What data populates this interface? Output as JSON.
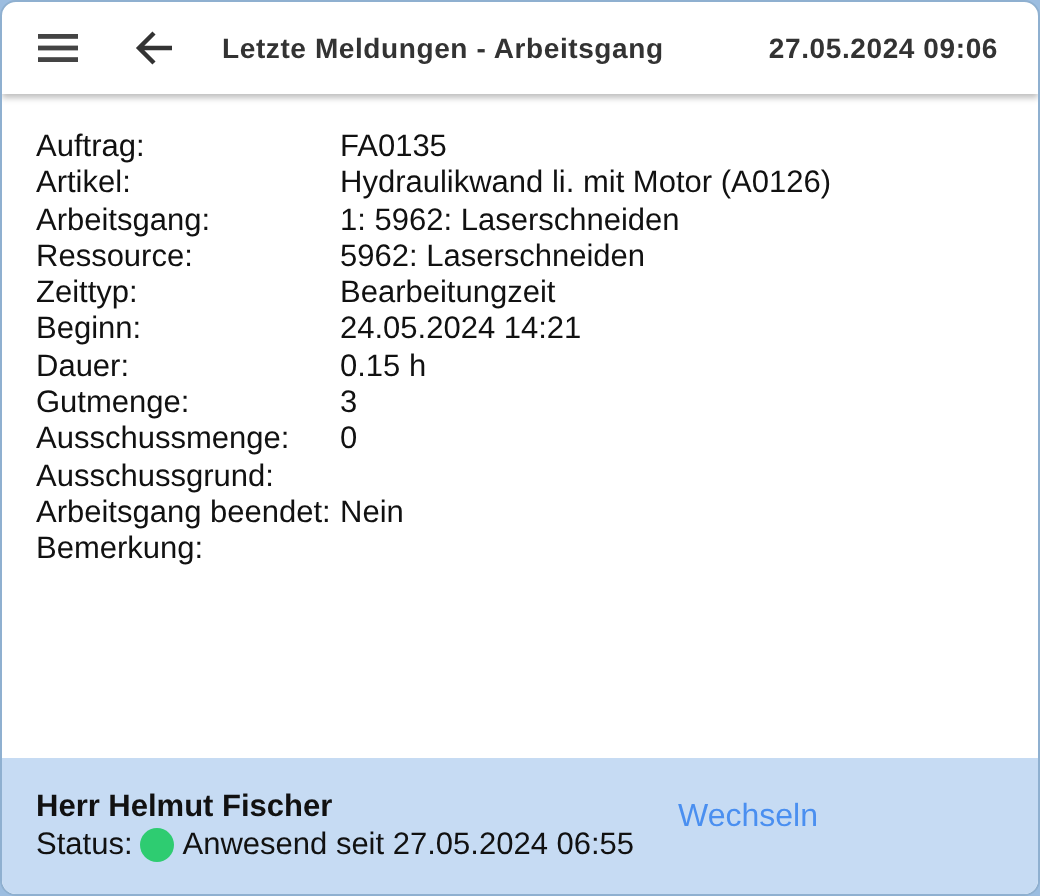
{
  "header": {
    "title": "Letzte Meldungen - Arbeitsgang",
    "datetime": "27.05.2024 09:06"
  },
  "fields": [
    {
      "label": "Auftrag:",
      "value": "FA0135"
    },
    {
      "label": "Artikel:",
      "value": "Hydraulikwand li. mit Motor (A0126)"
    },
    {
      "label": "Arbeitsgang:",
      "value": "1: 5962: Laserschneiden"
    },
    {
      "label": "Ressource:",
      "value": "5962: Laserschneiden"
    },
    {
      "label": "Zeittyp:",
      "value": "Bearbeitungzeit"
    },
    {
      "label": "Beginn:",
      "value": "24.05.2024 14:21"
    },
    {
      "label": "Dauer:",
      "value": "0.15 h"
    },
    {
      "label": "Gutmenge:",
      "value": "3"
    },
    {
      "label": "Ausschussmenge:",
      "value": "0"
    },
    {
      "label": "Ausschussgrund:"
    },
    {
      "label": "Arbeitsgang beendet:",
      "value": "Nein"
    },
    {
      "label": "Bemerkung:"
    }
  ],
  "footer": {
    "user": "Herr Helmut Fischer",
    "status": {
      "label": "Status:",
      "color": "#2ecc71",
      "text": "Anwesend seit 27.05.2024 06:55"
    },
    "switch_link": "Wechseln"
  }
}
